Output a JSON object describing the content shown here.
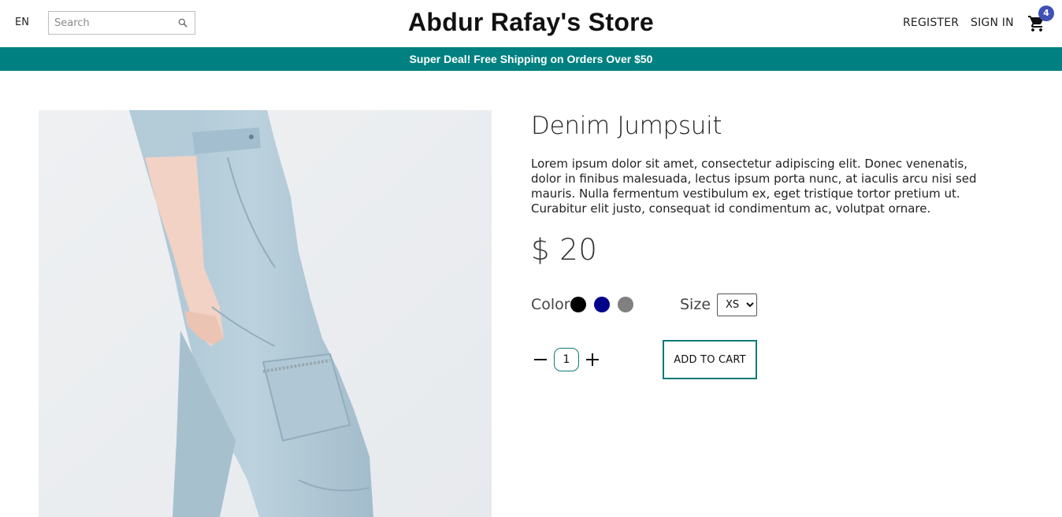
{
  "header": {
    "language": "EN",
    "search_placeholder": "Search",
    "store_name": "Abdur Rafay's Store",
    "register_label": "REGISTER",
    "signin_label": "SIGN IN",
    "cart_count": "4",
    "cart_icon": "shopping-cart-icon",
    "search_icon": "search-icon"
  },
  "announcement": "Super Deal! Free Shipping on Orders Over $50",
  "product": {
    "title": "Denim Jumpsuit",
    "description": "Lorem ipsum dolor sit amet, consectetur adipiscing elit. Donec venenatis, dolor in finibus malesuada, lectus ipsum porta nunc, at iaculis arcu nisi sed mauris. Nulla fermentum vestibulum ex, eget tristique tortor pretium ut. Curabitur elit justo, consequat id condimentum ac, volutpat ornare.",
    "price": "$ 20",
    "color_label": "Color",
    "colors": [
      "#000000",
      "#00008b",
      "#808080"
    ],
    "size_label": "Size",
    "size_selected": "XS",
    "quantity": "1",
    "add_to_cart_label": "ADD TO CART"
  },
  "theme": {
    "accent": "#008080",
    "badge": "#3f51b5"
  }
}
